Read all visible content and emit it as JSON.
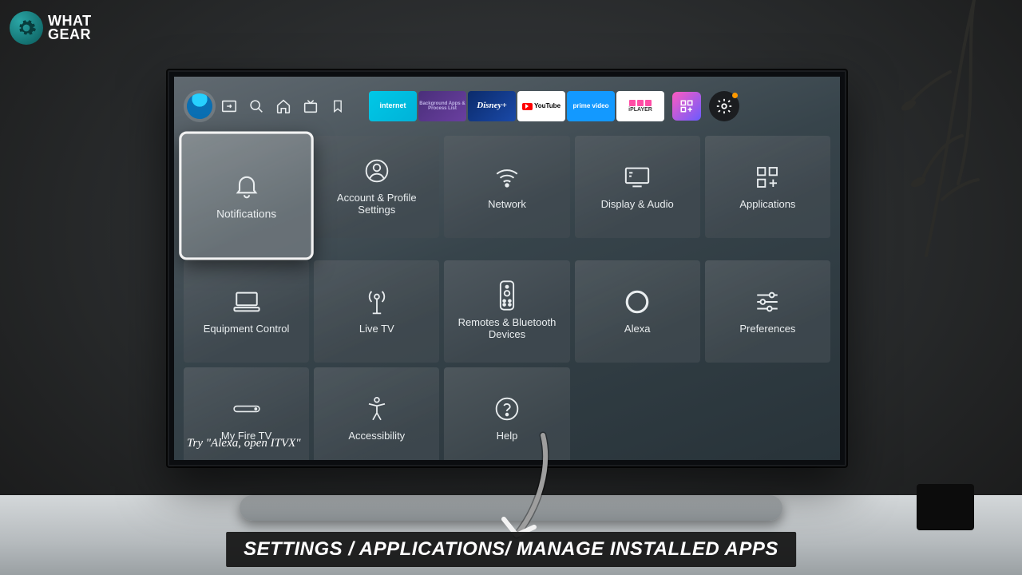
{
  "watermark": {
    "line1": "WHAT",
    "line2": "GEAR"
  },
  "nav": {
    "apps": [
      {
        "name": "internet",
        "label": "internet"
      },
      {
        "name": "background",
        "label": "Background Apps & Process List"
      },
      {
        "name": "disney",
        "label": "Disney+"
      },
      {
        "name": "youtube",
        "label": "YouTube"
      },
      {
        "name": "primevideo",
        "label": "prime video"
      },
      {
        "name": "iplayer",
        "label": "iPLAYER"
      }
    ]
  },
  "tiles": [
    {
      "id": "notifications",
      "label": "Notifications",
      "selected": true
    },
    {
      "id": "account",
      "label": "Account & Profile Settings"
    },
    {
      "id": "network",
      "label": "Network"
    },
    {
      "id": "display",
      "label": "Display & Audio"
    },
    {
      "id": "applications",
      "label": "Applications"
    },
    {
      "id": "equipment",
      "label": "Equipment Control"
    },
    {
      "id": "livetv",
      "label": "Live TV"
    },
    {
      "id": "remotes",
      "label": "Remotes & Bluetooth Devices"
    },
    {
      "id": "alexa",
      "label": "Alexa"
    },
    {
      "id": "preferences",
      "label": "Preferences"
    },
    {
      "id": "myfiretv",
      "label": "My Fire TV"
    },
    {
      "id": "accessibility",
      "label": "Accessibility"
    },
    {
      "id": "help",
      "label": "Help"
    }
  ],
  "hint": "Try \"Alexa, open ITVX\"",
  "caption": "SETTINGS / APPLICATIONS/ MANAGE INSTALLED APPS"
}
